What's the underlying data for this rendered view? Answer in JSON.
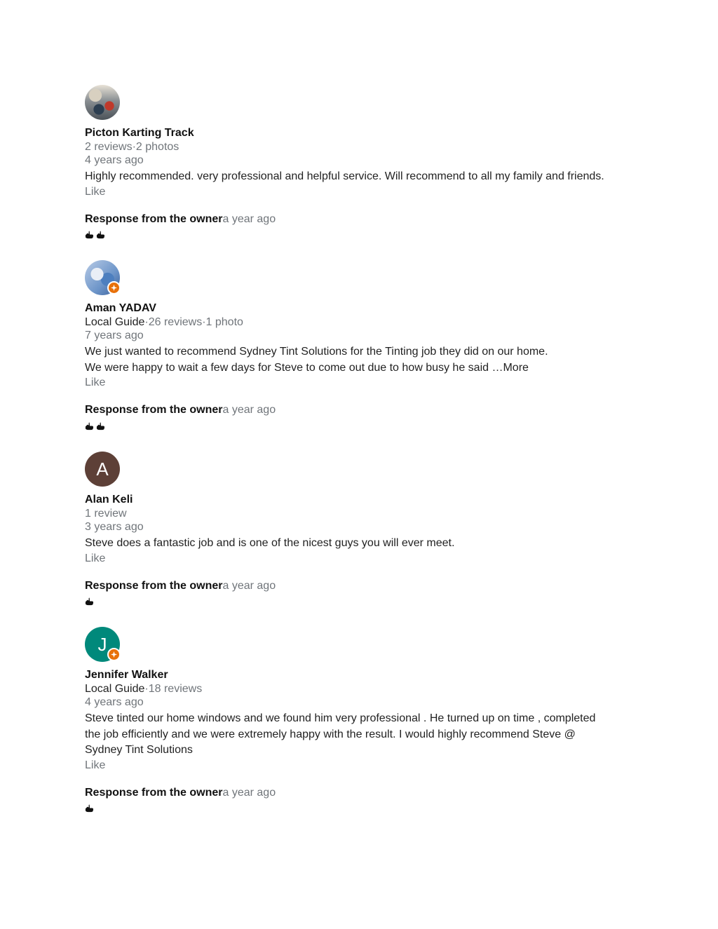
{
  "reviews": [
    {
      "avatar_type": "photo",
      "name": "Picton Karting Track",
      "local_guide": "",
      "meta": "2 reviews·2 photos",
      "ago": "4 years ago",
      "text_lines": [
        "Highly recommended. very professional and helpful service. Will recommend to all my family and friends."
      ],
      "like": "Like",
      "response_label": "Response from the owner",
      "response_ago": "a year ago",
      "response_icon_count": 2,
      "response_icon": "backhand-index-pointing-right-icon"
    },
    {
      "avatar_type": "photo",
      "name": "Aman YADAV",
      "local_guide": "Local Guide",
      "meta": "·26 reviews·1 photo",
      "ago": "7 years ago",
      "text_lines": [
        "We just wanted to recommend Sydney Tint Solutions for the Tinting job they did on our home.",
        "We were happy to wait a few days for Steve to come out due to how busy he said …More"
      ],
      "like": "Like",
      "response_label": "Response from the owner",
      "response_ago": "a year ago",
      "response_icon_count": 2,
      "response_icon": "backhand-index-pointing-right-icon"
    },
    {
      "avatar_type": "letter",
      "avatar_letter": "A",
      "avatar_color": "#5d4037",
      "name": "Alan Keli",
      "local_guide": "",
      "meta": "1 review",
      "ago": "3 years ago",
      "text_lines": [
        "Steve does a fantastic job and is one of the nicest guys you will ever meet."
      ],
      "like": "Like",
      "response_label": "Response from the owner",
      "response_ago": "a year ago",
      "response_icon_count": 1,
      "response_icon": "backhand-index-pointing-right-icon"
    },
    {
      "avatar_type": "letter",
      "avatar_letter": "J",
      "avatar_color": "#00897b",
      "name": "Jennifer Walker",
      "local_guide": "Local Guide",
      "meta": "·18 reviews",
      "ago": "4 years ago",
      "text_lines": [
        "Steve tinted our home windows and we found him very professional . He turned up on time , completed",
        "the job efficiently and we were extremely happy with the result. I would highly recommend Steve @",
        "Sydney Tint Solutions"
      ],
      "like": "Like",
      "response_label": "Response from the owner",
      "response_ago": "a year ago",
      "response_icon_count": 1,
      "response_icon": "backhand-index-pointing-right-icon"
    }
  ],
  "colors": {
    "badge": "#e8710a",
    "muted_text": "#70757a",
    "body_text": "#222222"
  }
}
